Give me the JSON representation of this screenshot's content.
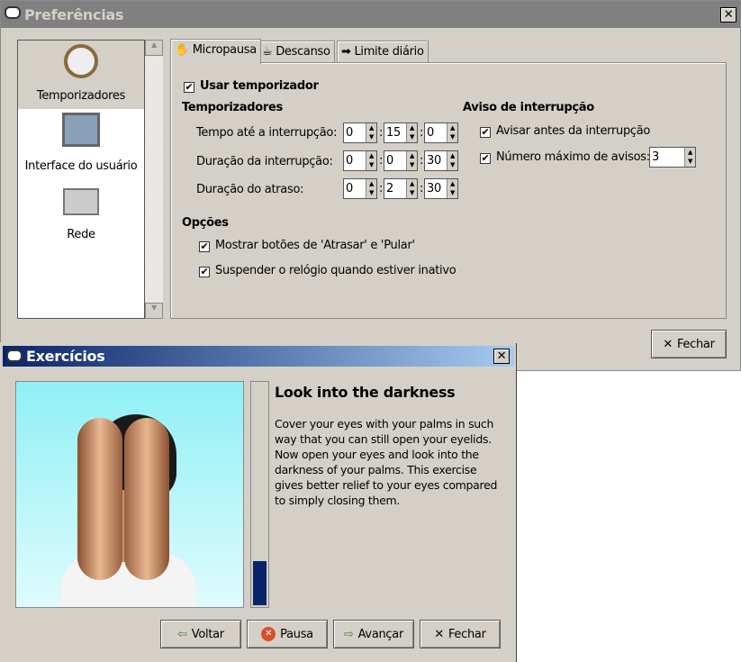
{
  "prefs": {
    "title": "Preferências",
    "sidebar": [
      {
        "label": "Temporizadores",
        "icon": "clock-icon"
      },
      {
        "label": "Interface do usuário",
        "icon": "monitor-icon"
      },
      {
        "label": "Rede",
        "icon": "network-icon"
      }
    ],
    "tabs": [
      "Micropausa",
      "Descanso",
      "Limite diário"
    ],
    "use_timer": "Usar temporizador",
    "timers_heading": "Temporizadores",
    "rows": [
      {
        "label": "Tempo até a interrupção:",
        "h": "0",
        "m": "15",
        "s": "0"
      },
      {
        "label": "Duração da interrupção:",
        "h": "0",
        "m": "0",
        "s": "30"
      },
      {
        "label": "Duração do atraso:",
        "h": "0",
        "m": "2",
        "s": "30"
      }
    ],
    "sep": ":",
    "options_heading": "Opções",
    "opt1": "Mostrar botões de 'Atrasar' e 'Pular'",
    "opt2": "Suspender o relógio quando estiver inativo",
    "warn_heading": "Aviso de interrupção",
    "warn1": "Avisar antes da interrupção",
    "warn2": "Número máximo de avisos:",
    "max_warn": "3",
    "close": "Fechar",
    "check": "✔",
    "x": "✕"
  },
  "exercise": {
    "title": "Exercícios",
    "heading": "Look into the darkness",
    "text": "Cover your eyes with your palms in such way that you can still open your eyelids. Now open your eyes and look into the darkness of your palms. This exercise gives better relief to your eyes compared to simply closing them.",
    "progress": 0.2,
    "buttons": {
      "back": "Voltar",
      "pause": "Pausa",
      "next": "Avançar",
      "close": "Fechar"
    }
  },
  "colors": {
    "active_title_start": "#0a246a",
    "active_title_end": "#a6caf0",
    "inactive_title": "#808080",
    "progress": "#0a246a"
  }
}
